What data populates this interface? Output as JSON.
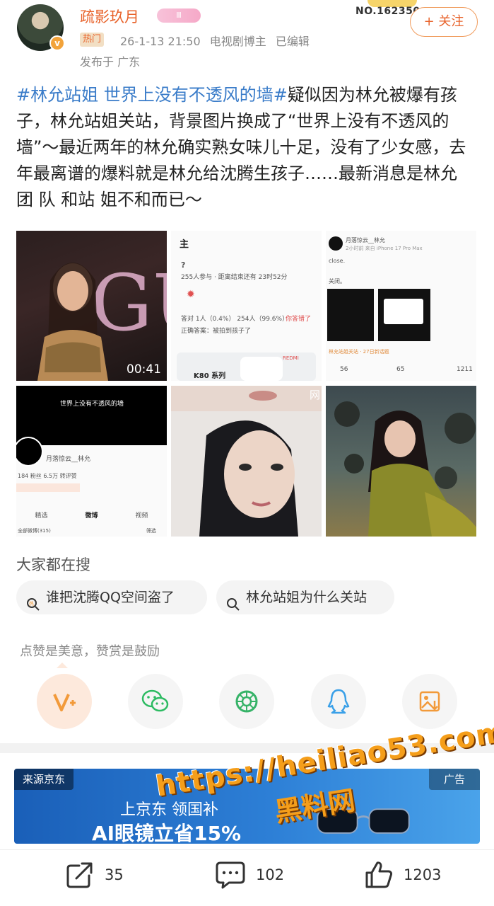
{
  "header": {
    "username": "疏影玖月",
    "vip_badge": "Ⅲ",
    "avatar_badge": "v",
    "hot_tag": "热门",
    "time": "26-1-13 21:50",
    "role": "电视剧博主",
    "edited": "已编辑",
    "location": "发布于 广东",
    "rank": "NO.162350",
    "follow_label": "+ 关注"
  },
  "post": {
    "hashtag": "#林允站姐 世界上没有不透风的墙#",
    "text": "疑似因为林允被爆有孩子，林允站姐关站，背景图片换成了“世界上没有不透风的墙”～最近两年的林允确实熟女味儿十足，没有了少女感，去年最离谱的爆料就是林允给沈腾生孩子……最新消息是林允 团 队 和站 姐不和而已～"
  },
  "images": {
    "video_duration": "00:41",
    "video_title": "GU",
    "t2": {
      "line1": "主",
      "line2": "?",
      "line3": "255人参与 · 距离结束还有 23时52分",
      "line4": "答对 1人（0.4%）  254人（99.6%）",
      "line4_red": "你答错了",
      "line5": "正确答案：被拍到孩子了",
      "brand": "REDMI",
      "series": "K80 系列"
    },
    "t3": {
      "name": "月落惊云__林允",
      "sub": "2小时前 来自 iPhone 17 Pro Max",
      "close": "close.",
      "switch": "关闭。",
      "tag": "林允站姐关站 · 27日新话题",
      "shares": "56",
      "comments": "65",
      "likes": "1211"
    },
    "t4": {
      "banner": "世界上没有不透风的墙",
      "name": "月落惊云__林允",
      "stats": "184 粉丝   6.5万 转评赞",
      "tabs": [
        "精选",
        "微博",
        "视频"
      ],
      "footer": "全部微博(315)",
      "filter": "筛选"
    },
    "t5": {
      "corner": "网"
    }
  },
  "search": {
    "title": "大家都在搜",
    "chips": [
      {
        "label": "谁把沈腾QQ空间盗了",
        "icon": "hot-search-icon"
      },
      {
        "label": "林允站姐为什么关站",
        "icon": "search-icon"
      }
    ]
  },
  "reward": {
    "text": "点赞是美意，赞赏是鼓励"
  },
  "ad": {
    "source": "来源京东",
    "label": "广告",
    "line1": "上京东 领国补",
    "line2": "AI眼镜立省15%"
  },
  "watermark": {
    "url": "https://heiliao53.com",
    "site": "黑料网"
  },
  "actions": {
    "share_count": "35",
    "comment_count": "102",
    "like_count": "1203"
  },
  "colors": {
    "accent": "#e8632b",
    "hashtag": "#3a7cc9",
    "wechat": "#2dbb62",
    "moments": "#36b368",
    "qq": "#3aa0e8",
    "save": "#f29a3a"
  }
}
